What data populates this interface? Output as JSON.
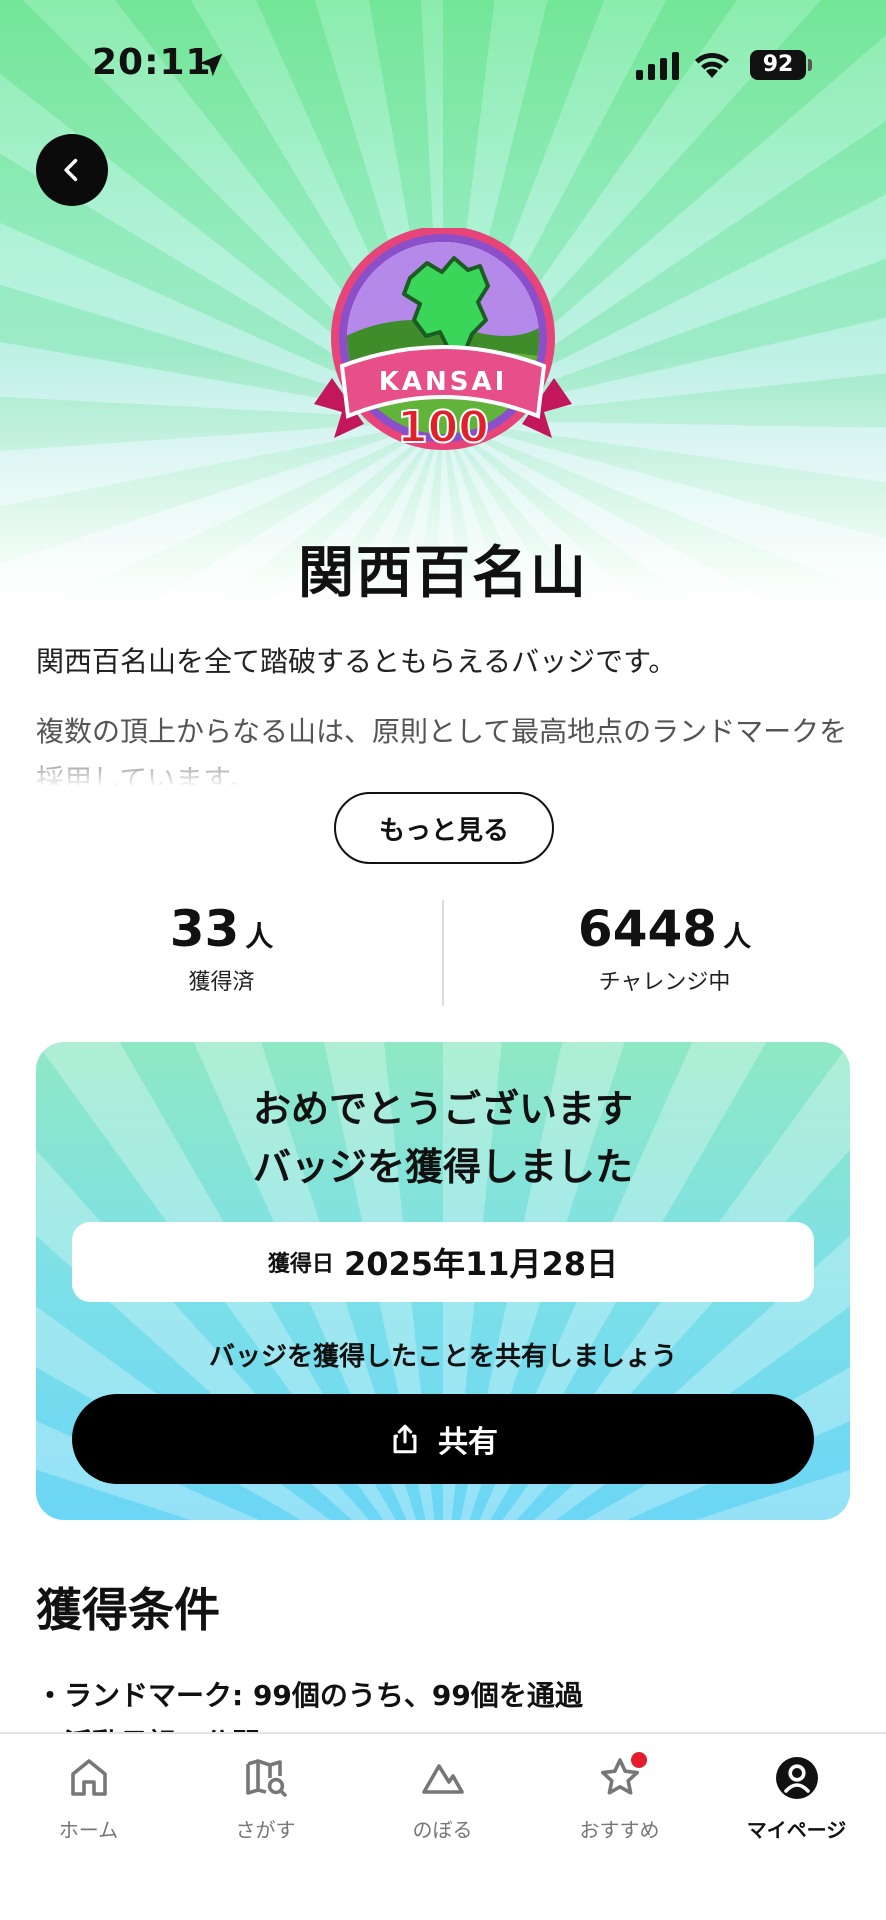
{
  "status_bar": {
    "time": "20:11",
    "battery": "92",
    "icons": [
      "location-arrow-icon",
      "signal-icon",
      "wifi-icon",
      "battery-icon"
    ]
  },
  "header": {
    "back_icon": "chevron-left-icon"
  },
  "badge": {
    "emblem_text": "KANSAI",
    "emblem_number": "100",
    "title": "関西百名山"
  },
  "description": {
    "paragraph1": "関西百名山を全て踏破するともらえるバッジです。",
    "paragraph2": "複数の頂上からなる山は、原則として最高地点のランドマークを採用しています。",
    "more_label": "もっと見る"
  },
  "stats": {
    "earned": {
      "value": "33",
      "unit": "人",
      "label": "獲得済"
    },
    "challenging": {
      "value": "6448",
      "unit": "人",
      "label": "チャレンジ中"
    }
  },
  "congrats": {
    "line1": "おめでとうございます",
    "line2": "バッジを獲得しました",
    "date_label": "獲得日",
    "date_value": "2025年11月28日",
    "share_prompt": "バッジを獲得したことを共有しましょう",
    "share_label": "共有"
  },
  "conditions": {
    "title": "獲得条件",
    "items": [
      "・ランドマーク: 99個のうち、99個を通過",
      "・活動日記　公開"
    ]
  },
  "tabs": [
    {
      "label": "ホーム",
      "icon": "home-icon"
    },
    {
      "label": "さがす",
      "icon": "map-search-icon"
    },
    {
      "label": "のぼる",
      "icon": "mountain-icon"
    },
    {
      "label": "おすすめ",
      "icon": "star-icon"
    },
    {
      "label": "マイページ",
      "icon": "user-icon"
    }
  ],
  "colors": {
    "accent_dark": "#000000",
    "card_green": "#8fe8c4",
    "card_blue": "#6bd6f5",
    "notification": "#e51c2c"
  }
}
